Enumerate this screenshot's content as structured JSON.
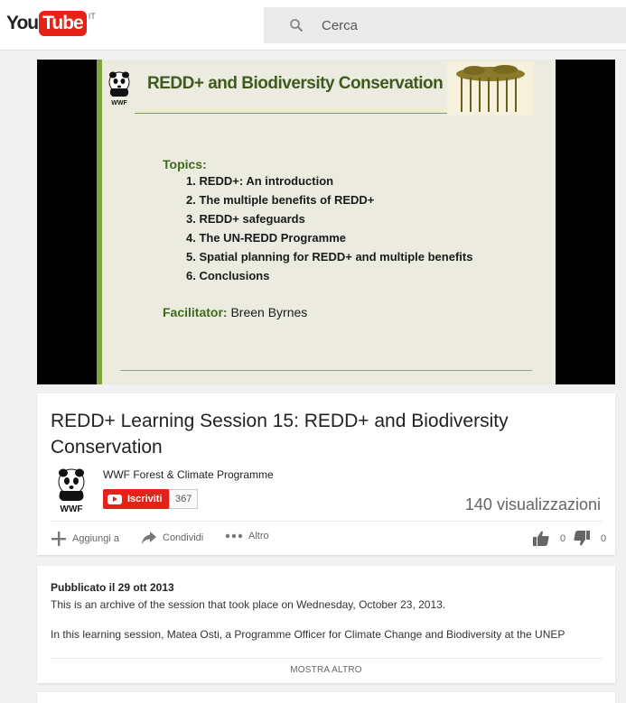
{
  "header": {
    "logo_you": "You",
    "logo_tube": "Tube",
    "region": "IT",
    "search_placeholder": "Cerca"
  },
  "video": {
    "slide_title": "REDD+ and Biodiversity Conservation",
    "slide_logo_text": "WWF",
    "topics_label": "Topics:",
    "topics": [
      "1. REDD+: An introduction",
      "2. The multiple benefits of REDD+",
      "3. REDD+ safeguards",
      "4. The UN-REDD Programme",
      "5. Spatial planning for REDD+ and multiple benefits",
      "6. Conclusions"
    ],
    "facilitator_label": "Facilitator:",
    "facilitator_name": "Breen Byrnes"
  },
  "info": {
    "title": "REDD+ Learning Session 15: REDD+ and Biodiversity Conservation",
    "channel_name": "WWF Forest & Climate Programme",
    "channel_logo_text": "WWF",
    "subscribe_label": "Iscriviti",
    "subscriber_count": "367",
    "views": "140 visualizzazioni",
    "actions": {
      "add_label": "Aggiungi a",
      "share_label": "Condividi",
      "more_label": "Altro"
    },
    "likes": "0",
    "dislikes": "0"
  },
  "description": {
    "published": "Pubblicato il 29 ott 2013",
    "line1": "This is an archive of the session that took place on Wednesday, October 23, 2013.",
    "line2": "In this learning session, Matea Osti, a Programme Officer for Climate Change and Biodiversity at the UNEP",
    "show_more": "MOSTRA ALTRO"
  },
  "colors": {
    "brand_red": "#e62117",
    "slide_green": "#7ea43b",
    "slide_title": "#3f5a1e"
  }
}
